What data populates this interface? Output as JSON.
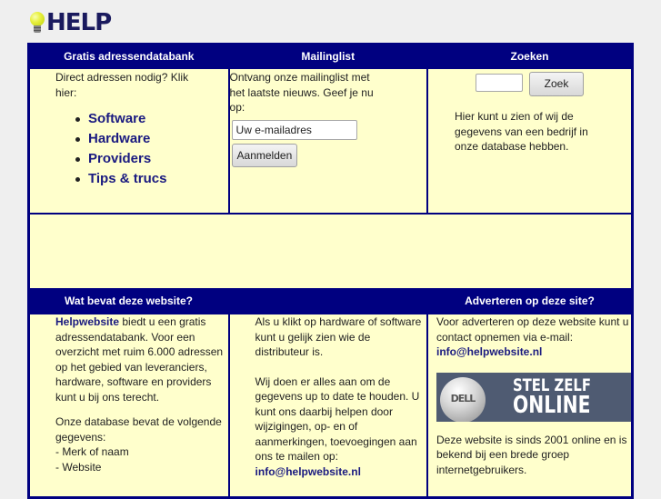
{
  "logo": {
    "icon": "lightbulb-icon",
    "text": "HELP"
  },
  "sections": {
    "addresses": {
      "title": "Gratis adressendatabank",
      "intro": "Direct adressen nodig? Klik hier:",
      "links": [
        "Software",
        "Hardware",
        "Providers",
        "Tips & trucs"
      ]
    },
    "mailinglist": {
      "title": "Mailinglist",
      "intro": "Ontvang onze mailinglist met het laatste nieuws. Geef je nu op:",
      "email_value": "Uw e-mailadres",
      "signup_label": "Aanmelden"
    },
    "search": {
      "title": "Zoeken",
      "input_value": "",
      "button_label": "Zoek",
      "description": "Hier kunt u zien of wij de gegevens van een bedrijf in onze database hebben."
    },
    "about": {
      "title": "Wat bevat deze website?",
      "brand_link": "Helpwebsite",
      "para1_rest": " biedt u een gratis adressendatabank. Voor een overzicht met ruim 6.000 adressen op het gebied van leveranciers, hardware, software en providers kunt u bij ons terecht.",
      "para2": "Onze database bevat de volgende gegevens:",
      "fields": [
        "- Merk of naam",
        "- Website"
      ],
      "col2_para1": "Als u klikt op hardware of software kunt u gelijk zien wie de distributeur is.",
      "col2_para2": "Wij doen er alles aan om de gegevens up to date te houden. U kunt ons daarbij helpen door wijzigingen, op- en of aanmerkingen, toevoegingen aan ons te mailen op:",
      "col2_email": "info@helpwebsite.nl"
    },
    "advertise": {
      "title": "Adverteren op deze site?",
      "intro": "Voor adverteren op deze website kunt u contact opnemen via e-mail:",
      "email": "info@helpwebsite.nl",
      "banner": {
        "brand": "DELL",
        "line1": "STEL ZELF",
        "line2": "ONLINE"
      },
      "footer": "Deze website is sinds 2001 online en is bekend bij een brede groep internetgebruikers."
    }
  },
  "colors": {
    "header_bg": "#000080",
    "cell_bg": "#ffffcc",
    "link": "#1a1a80",
    "page_bg": "#efefef"
  }
}
